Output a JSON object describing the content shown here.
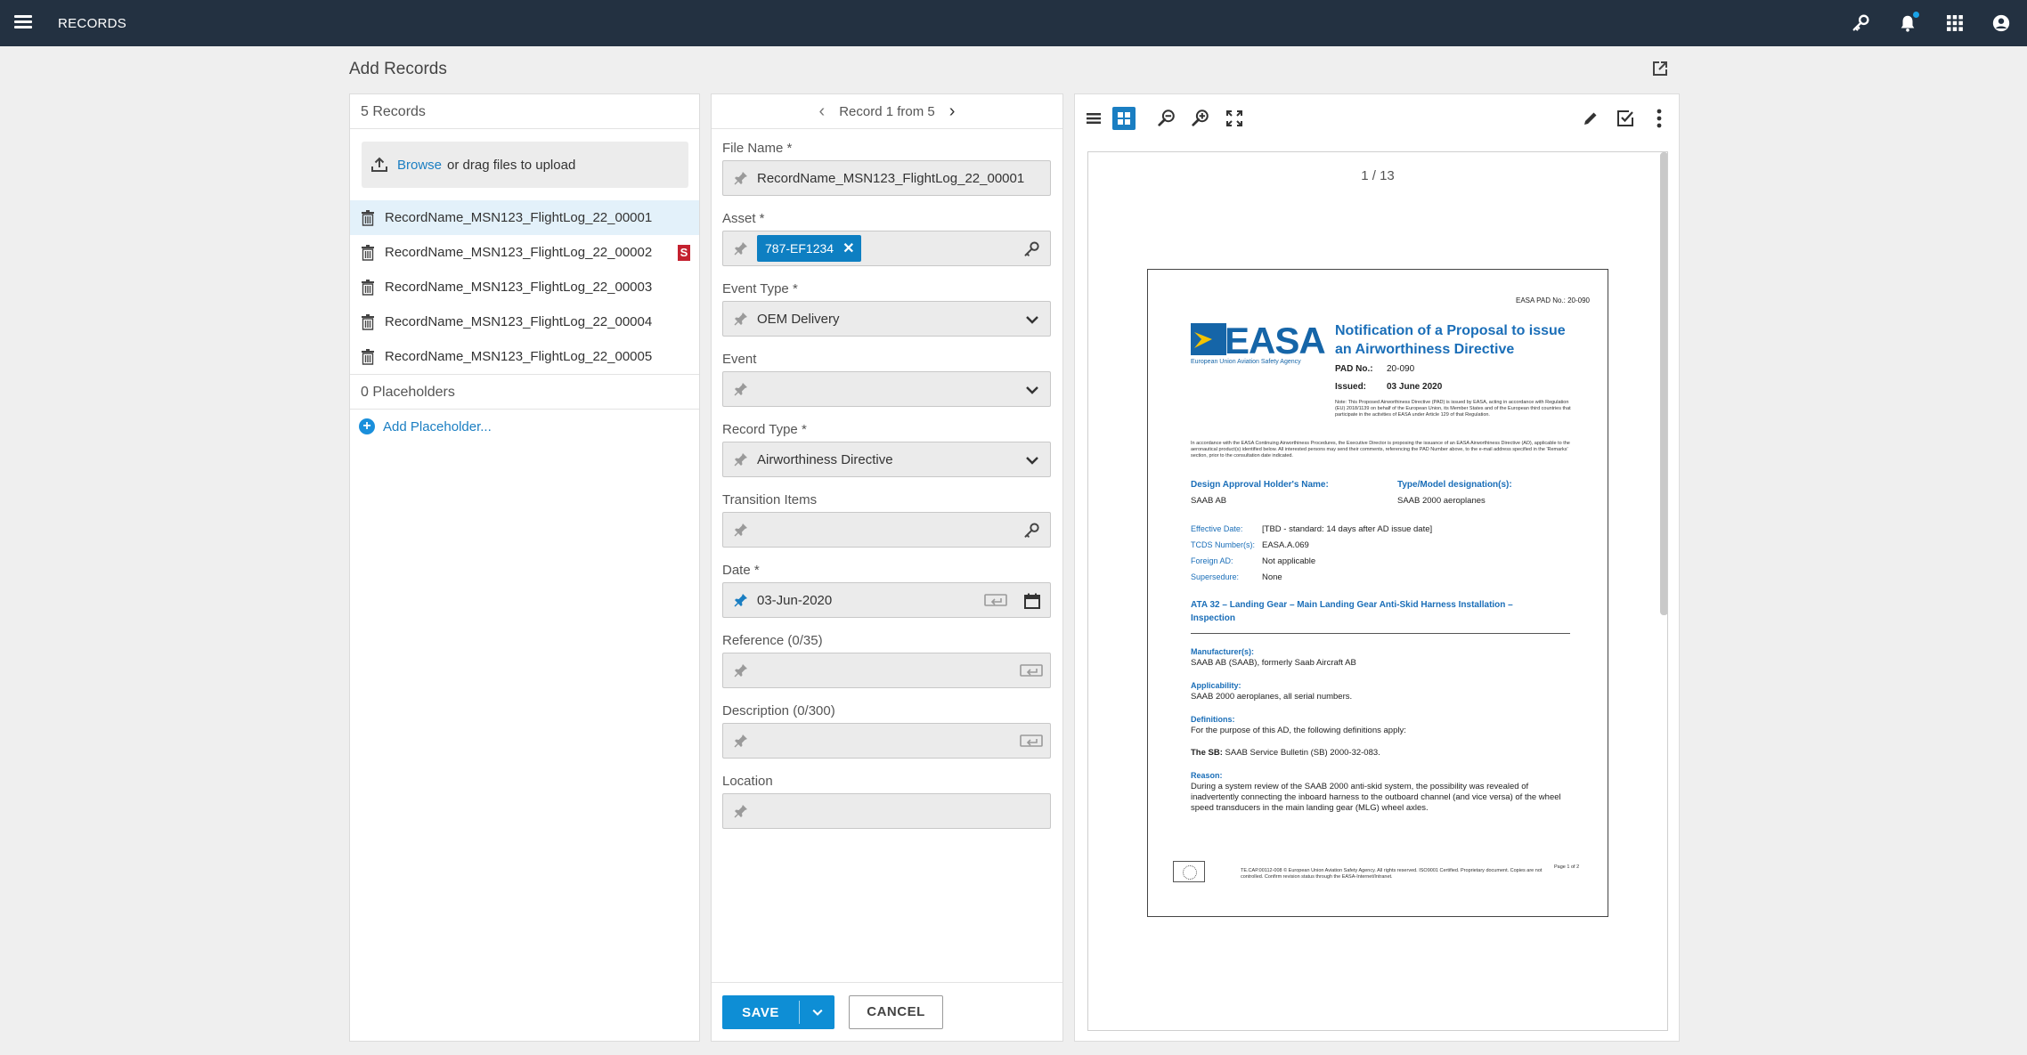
{
  "topbar": {
    "title": "RECORDS"
  },
  "page": {
    "title": "Add Records"
  },
  "records_panel": {
    "count_label": "5 Records",
    "upload": {
      "link": "Browse",
      "text": "or drag files to upload"
    },
    "records": [
      "RecordName_MSN123_FlightLog_22_00001",
      "RecordName_MSN123_FlightLog_22_00002",
      "RecordName_MSN123_FlightLog_22_00003",
      "RecordName_MSN123_FlightLog_22_00004",
      "RecordName_MSN123_FlightLog_22_00005"
    ],
    "badge": "S",
    "placeholders_label": "0 Placeholders",
    "add_placeholder": "Add Placeholder..."
  },
  "form": {
    "nav_label": "Record 1 from 5",
    "file_name": {
      "label": "File Name *",
      "value": "RecordName_MSN123_FlightLog_22_00001"
    },
    "asset": {
      "label": "Asset *",
      "chip": "787-EF1234"
    },
    "event_type": {
      "label": "Event Type *",
      "value": "OEM Delivery"
    },
    "event": {
      "label": "Event",
      "value": ""
    },
    "record_type": {
      "label": "Record Type *",
      "value": "Airworthiness Directive"
    },
    "transition_items": {
      "label": "Transition Items",
      "value": ""
    },
    "date": {
      "label": "Date *",
      "value": "03-Jun-2020"
    },
    "reference": {
      "label": "Reference  (0/35)",
      "value": ""
    },
    "description": {
      "label": "Description  (0/300)",
      "value": ""
    },
    "location": {
      "label": "Location",
      "value": ""
    },
    "save_label": "SAVE",
    "cancel_label": "CANCEL"
  },
  "preview": {
    "page_count": "1 / 13",
    "doc": {
      "pad_no_header": "EASA PAD No.: 20-090",
      "logo_word": "EASA",
      "logo_sub": "European Union Aviation Safety Agency",
      "title": "Notification of a Proposal to issue an Airworthiness Directive",
      "pad_label": "PAD No.:",
      "pad_value": "20-090",
      "issued_label": "Issued:",
      "issued_value": "03 June 2020",
      "note": "Note: This Proposed Airworthiness Directive (PAD) is issued by EASA, acting in accordance with Regulation (EU) 2018/1139 on behalf of the European Union, its Member States and of the European third countries that participate in the activities of EASA under Article 129 of that Regulation.",
      "intro": "In accordance with the EASA Continuing Airworthiness Procedures, the Executive Director is proposing the issuance of an EASA Airworthiness Directive (AD), applicable to the aeronautical product(s) identified below. All interested persons may send their comments, referencing the PAD Number above, to the e-mail address specified in the 'Remarks' section, prior to the consultation date indicated.",
      "holder_label": "Design Approval Holder's Name:",
      "holder_value": "SAAB AB",
      "type_label": "Type/Model designation(s):",
      "type_value": "SAAB 2000 aeroplanes",
      "effective_label": "Effective Date:",
      "effective_value": "[TBD - standard: 14 days after AD issue date]",
      "tcds_label": "TCDS Number(s):",
      "tcds_value": "EASA.A.069",
      "foreign_label": "Foreign AD:",
      "foreign_value": "Not applicable",
      "supersedure_label": "Supersedure:",
      "supersedure_value": "None",
      "ata": "ATA 32 – Landing Gear – Main Landing Gear Anti-Skid Harness Installation – Inspection",
      "manufacturer_label": "Manufacturer(s):",
      "manufacturer_value": "SAAB AB (SAAB), formerly Saab Aircraft AB",
      "applicability_label": "Applicability:",
      "applicability_value": "SAAB 2000 aeroplanes, all serial numbers.",
      "definitions_label": "Definitions:",
      "definitions_value": "For the purpose of this AD, the following definitions apply:",
      "sb_bold": "The SB:",
      "sb_value": "SAAB Service Bulletin (SB) 2000-32-083.",
      "reason_label": "Reason:",
      "reason_value": "During a system review of the SAAB 2000 anti-skid system, the possibility was revealed of inadvertently connecting the inboard harness to the outboard channel (and vice versa) of the wheel speed transducers in the main landing gear (MLG) wheel axles.",
      "footer_text": "TE.CAP.00112-008 © European Union Aviation Safety Agency. All rights reserved. ISO9001 Certified. Proprietary document. Copies are not controlled. Confirm revision status through the EASA-Internet/Intranet.",
      "page_of": "Page 1 of 2"
    }
  }
}
